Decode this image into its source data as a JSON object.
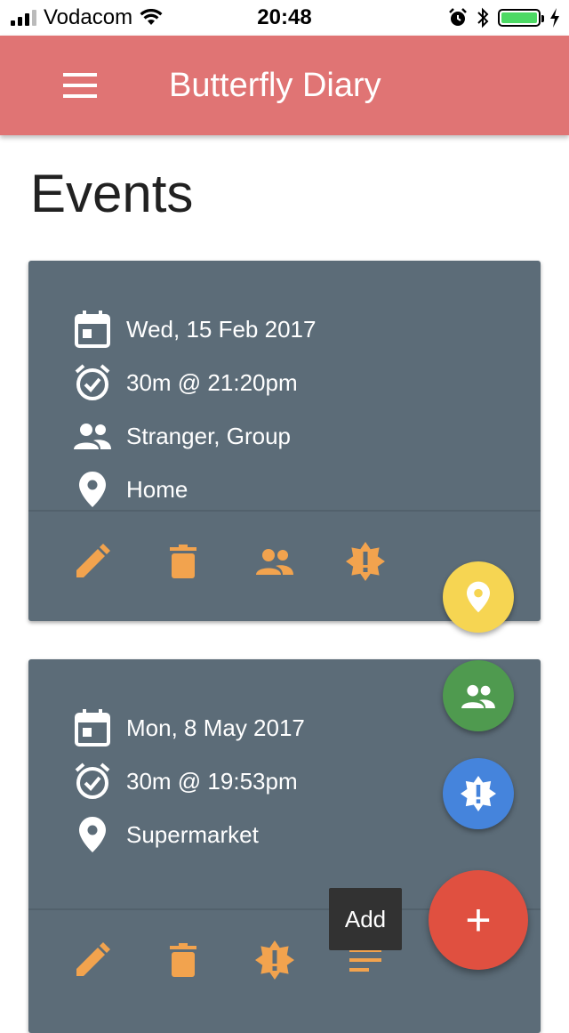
{
  "status_bar": {
    "carrier": "Vodacom",
    "time": "20:48"
  },
  "app_bar": {
    "title": "Butterfly Diary",
    "menu_icon": "menu-icon"
  },
  "page": {
    "title": "Events"
  },
  "events": [
    {
      "date": "Wed, 15 Feb 2017",
      "time": "30m @ 21:20pm",
      "people": "Stranger, Group",
      "location": "Home",
      "actions": [
        "edit-icon",
        "delete-icon",
        "people-icon",
        "alert-icon"
      ]
    },
    {
      "date": "Mon, 8 May 2017",
      "time": "30m @ 19:53pm",
      "location": "Supermarket",
      "actions": [
        "edit-icon",
        "delete-icon",
        "alert-icon",
        "notes-icon"
      ]
    }
  ],
  "fab_menu": {
    "items": [
      {
        "icon": "location-pin-icon",
        "color": "#f6d552"
      },
      {
        "icon": "people-icon",
        "color": "#4f9a4f"
      },
      {
        "icon": "alert-icon",
        "color": "#4584dc"
      }
    ],
    "main": {
      "label": "+",
      "color": "#e05040",
      "tooltip": "Add"
    }
  },
  "colors": {
    "app_bar": "#e07474",
    "card": "#5c6c78",
    "action_icon": "#f2a34e"
  }
}
